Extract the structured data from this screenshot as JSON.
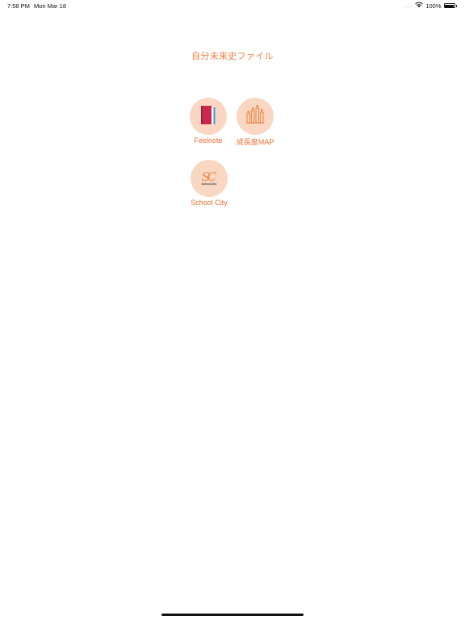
{
  "status_bar": {
    "time": "7:58 PM",
    "date": "Mon Mar 18",
    "signal": "....",
    "battery_percent": "100%",
    "battery_level": 1.0
  },
  "page": {
    "title": "自分未来史ファイル"
  },
  "apps": [
    {
      "label": "Feelnote",
      "icon": "books-icon"
    },
    {
      "label": "成長度MAP",
      "icon": "bar-chart-icon"
    },
    {
      "label": "School City",
      "icon": "school-city-logo-icon",
      "logo_text": "SchoolCity"
    }
  ],
  "colors": {
    "accent": "#ef7e3e",
    "icon_bg": "#f9d7c3",
    "book_red": "#c8294f",
    "book_blue": "#4a8ec9",
    "chart_orange": "#f0884a"
  }
}
